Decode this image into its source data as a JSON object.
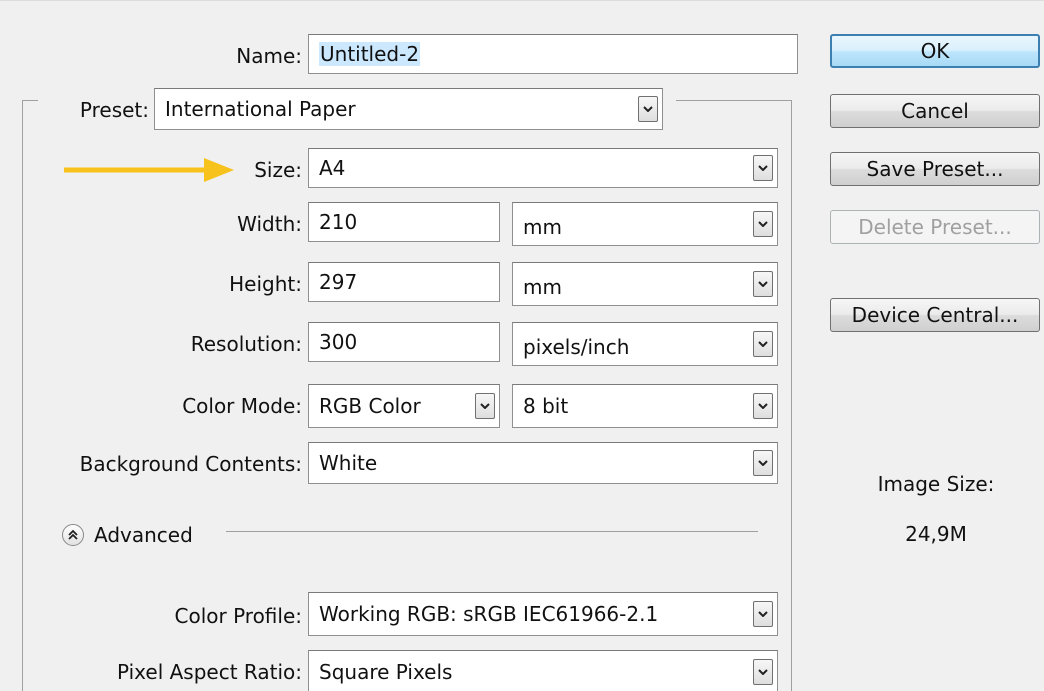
{
  "name": {
    "label": "Name:",
    "value": "Untitled-2"
  },
  "preset": {
    "label": "Preset:",
    "value": "International Paper"
  },
  "size": {
    "label": "Size:",
    "value": "A4"
  },
  "width": {
    "label": "Width:",
    "value": "210",
    "unit": "mm"
  },
  "height": {
    "label": "Height:",
    "value": "297",
    "unit": "mm"
  },
  "resolution": {
    "label": "Resolution:",
    "value": "300",
    "unit": "pixels/inch"
  },
  "color_mode": {
    "label": "Color Mode:",
    "value": "RGB Color",
    "bit_depth": "8 bit"
  },
  "background_contents": {
    "label": "Background Contents:",
    "value": "White"
  },
  "advanced": {
    "label": "Advanced"
  },
  "color_profile": {
    "label": "Color Profile:",
    "value": "Working RGB:  sRGB IEC61966-2.1"
  },
  "pixel_aspect_ratio": {
    "label": "Pixel Aspect Ratio:",
    "value": "Square Pixels"
  },
  "buttons": {
    "ok": "OK",
    "cancel": "Cancel",
    "save_preset": "Save Preset...",
    "delete_preset": "Delete Preset...",
    "device_central": "Device Central..."
  },
  "image_size": {
    "label": "Image Size:",
    "value": "24,9M"
  },
  "colors": {
    "annotation_arrow": "#f8c21c",
    "default_button_border": "#3c7fb1",
    "selection_highlight": "#cce8ff"
  },
  "icons": {
    "dropdown": "chevron-down-icon",
    "advanced_toggle": "double-chevron-up-icon",
    "annotation": "arrow-right-icon"
  }
}
